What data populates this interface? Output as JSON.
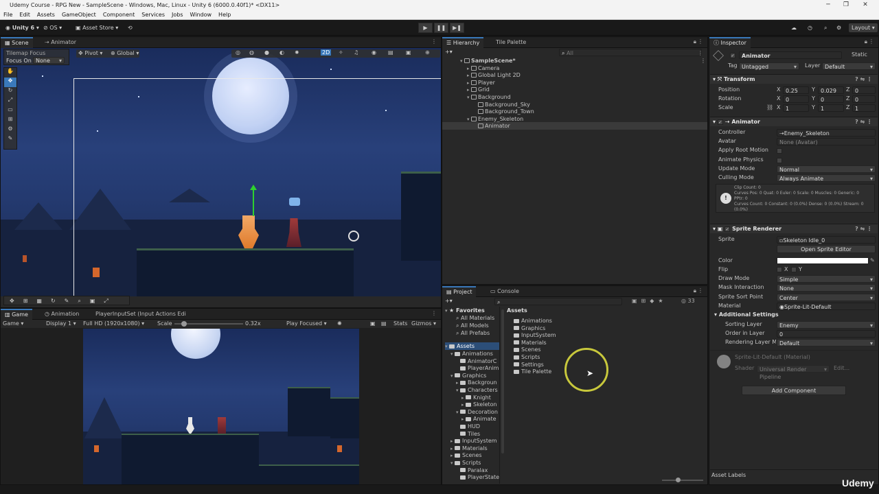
{
  "window": {
    "title": "Udemy Course - RPG New - SampleScene - Windows, Mac, Linux - Unity 6 (6000.0.40f1)* <DX11>"
  },
  "menu": [
    "File",
    "Edit",
    "Assets",
    "GameObject",
    "Component",
    "Services",
    "Jobs",
    "Window",
    "Help"
  ],
  "toolbar": {
    "account": "Unity 6",
    "os": "OS",
    "asset_store": "Asset Store",
    "layout": "Layout"
  },
  "scene_panel": {
    "tabs": [
      "Scene",
      "Animator"
    ],
    "tilemap_focus": "Tilemap Focus",
    "focus_on": "Focus On",
    "focus_value": "None",
    "pivot": "Pivot",
    "global": "Global",
    "mode_2d": "2D"
  },
  "game_panel": {
    "tabs": [
      "Game",
      "Animation",
      "PlayerInputSet (Input Actions Edi"
    ],
    "game_dd": "Game",
    "display": "Display 1",
    "resolution": "Full HD (1920x1080)",
    "scale_label": "Scale",
    "scale_value": "0.32x",
    "play_focused": "Play Focused",
    "stats": "Stats",
    "gizmos": "Gizmos",
    "scale_fraction": 0.14
  },
  "hierarchy": {
    "tabs": [
      "Hierarchy",
      "Tile Palette"
    ],
    "search_placeholder": "All",
    "items": [
      {
        "label": "SampleScene*",
        "indent": 0
      },
      {
        "label": "Camera",
        "indent": 1
      },
      {
        "label": "Global Light 2D",
        "indent": 1
      },
      {
        "label": "Player",
        "indent": 1
      },
      {
        "label": "Grid",
        "indent": 1
      },
      {
        "label": "Background",
        "indent": 1
      },
      {
        "label": "Background_Sky",
        "indent": 2
      },
      {
        "label": "Background_Town",
        "indent": 2
      },
      {
        "label": "Enemy_Skeleton",
        "indent": 1
      },
      {
        "label": "Animator",
        "indent": 2
      }
    ]
  },
  "project": {
    "tabs": [
      "Project",
      "Console"
    ],
    "count": "33",
    "favorites": {
      "title": "Favorites",
      "items": [
        "All Materials",
        "All Models",
        "All Prefabs"
      ]
    },
    "tree_root": "Assets",
    "tree": [
      {
        "label": "Animations",
        "indent": 1
      },
      {
        "label": "AnimatorC",
        "indent": 2
      },
      {
        "label": "PlayerAnim",
        "indent": 2
      },
      {
        "label": "Graphics",
        "indent": 1
      },
      {
        "label": "Backgroun",
        "indent": 2
      },
      {
        "label": "Characters",
        "indent": 2
      },
      {
        "label": "Knight",
        "indent": 3
      },
      {
        "label": "Skeleton",
        "indent": 3
      },
      {
        "label": "Decoration",
        "indent": 2
      },
      {
        "label": "Animate",
        "indent": 3
      },
      {
        "label": "HUD",
        "indent": 2
      },
      {
        "label": "Tiles",
        "indent": 2
      },
      {
        "label": "InputSystem",
        "indent": 1
      },
      {
        "label": "Materials",
        "indent": 1
      },
      {
        "label": "Scenes",
        "indent": 1
      },
      {
        "label": "Scripts",
        "indent": 1
      },
      {
        "label": "Paralax",
        "indent": 2
      },
      {
        "label": "PlayerState",
        "indent": 2
      }
    ],
    "breadcrumb": "Assets",
    "folders": [
      "Animations",
      "Graphics",
      "InputSystem",
      "Materials",
      "Scenes",
      "Scripts",
      "Settings",
      "Tile Palette"
    ]
  },
  "inspector": {
    "tab": "Inspector",
    "object_name": "Animator",
    "static": "Static",
    "tag_label": "Tag",
    "tag": "Untagged",
    "layer_label": "Layer",
    "layer": "Default",
    "transform": {
      "title": "Transform",
      "position_label": "Position",
      "position": {
        "x": "0.25",
        "y": "0.029",
        "z": "0"
      },
      "rotation_label": "Rotation",
      "rotation": {
        "x": "0",
        "y": "0",
        "z": "0"
      },
      "scale_label": "Scale",
      "scale": {
        "x": "1",
        "y": "1",
        "z": "1"
      },
      "axis": {
        "x": "X",
        "y": "Y",
        "z": "Z"
      }
    },
    "animator": {
      "title": "Animator",
      "controller_label": "Controller",
      "controller": "Enemy_Skeleton",
      "avatar_label": "Avatar",
      "avatar": "None (Avatar)",
      "root_motion_label": "Apply Root Motion",
      "physics_label": "Animate Physics",
      "update_mode_label": "Update Mode",
      "update_mode": "Normal",
      "culling_label": "Culling Mode",
      "culling": "Always Animate",
      "info_lines": [
        "Clip Count: 0",
        "Curves Pos: 0 Quat: 0 Euler: 0 Scale: 0 Muscles: 0 Generic: 0",
        "PPtr: 0",
        "Curves Count: 0 Constant: 0 (0.0%) Dense: 0 (0.0%) Stream: 0",
        "(0.0%)"
      ]
    },
    "sprite_renderer": {
      "title": "Sprite Renderer",
      "sprite_label": "Sprite",
      "sprite": "Skeleton Idle_0",
      "open_editor": "Open Sprite Editor",
      "color_label": "Color",
      "color": "#ffffff",
      "flip_label": "Flip",
      "flip_x": "X",
      "flip_y": "Y",
      "draw_mode_label": "Draw Mode",
      "draw_mode": "Simple",
      "mask_label": "Mask Interaction",
      "mask": "None",
      "sort_point_label": "Sprite Sort Point",
      "sort_point": "Center",
      "material_label": "Material",
      "material": "Sprite-Lit-Default"
    },
    "additional": {
      "title": "Additional Settings",
      "sorting_layer_label": "Sorting Layer",
      "sorting_layer": "Enemy",
      "order_label": "Order in Layer",
      "order": "0",
      "rendering_label": "Rendering Layer Ma",
      "rendering": "Default"
    },
    "material_preview": {
      "name": "Sprite-Lit-Default (Material)",
      "shader_label": "Shader",
      "shader": "Universal Render Pipeline",
      "edit": "Edit..."
    },
    "add_component": "Add Component",
    "asset_labels": "Asset Labels"
  },
  "watermark": "Udemy",
  "colors": {
    "accent": "#3a79bb",
    "cursor_ring": "#c8c83c"
  }
}
